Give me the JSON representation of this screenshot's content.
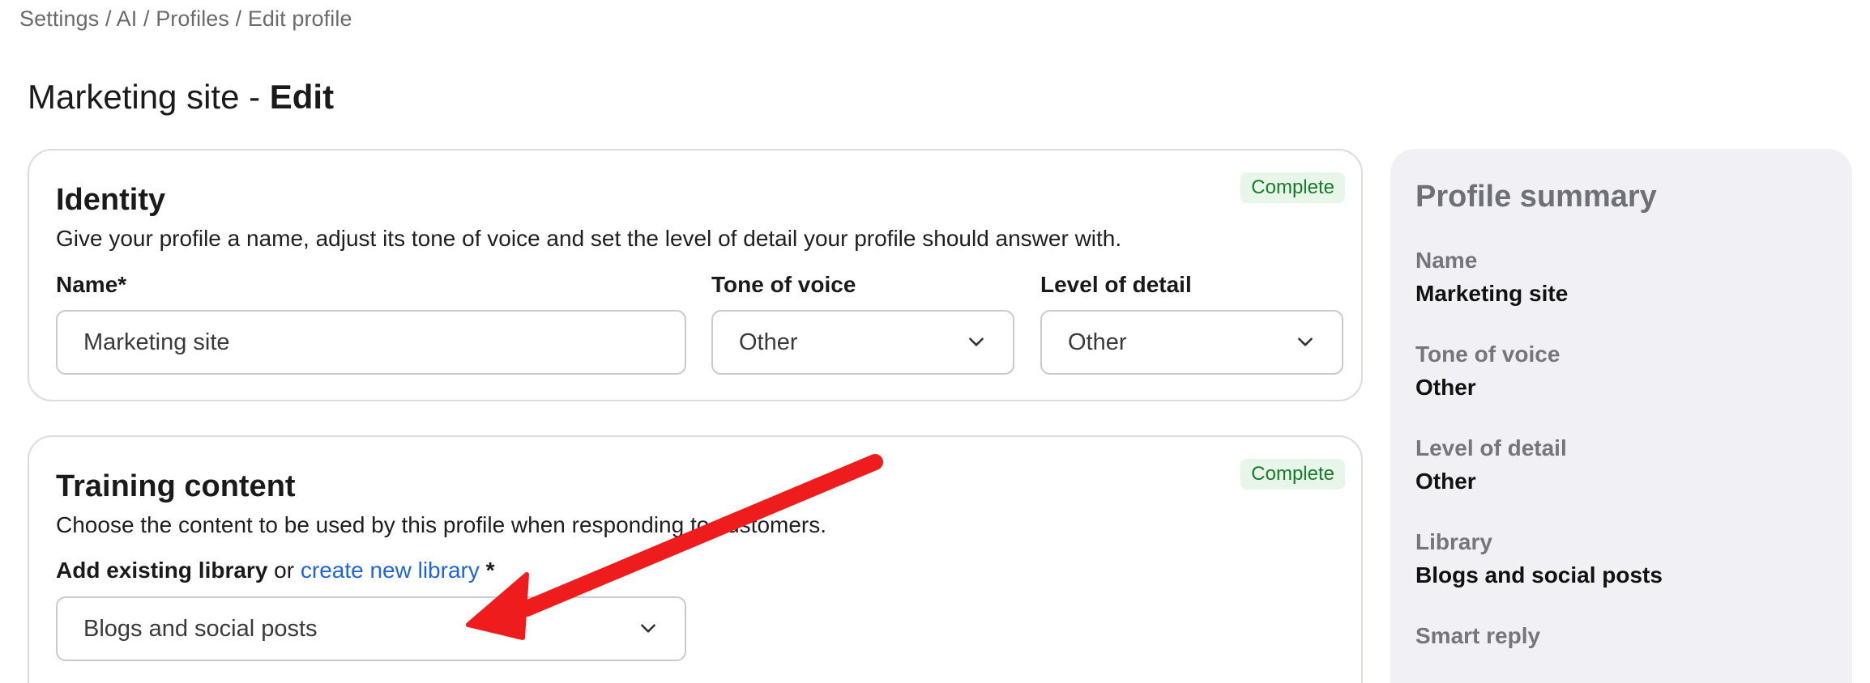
{
  "breadcrumb": "Settings / AI / Profiles / Edit profile",
  "page_title": {
    "name": "Marketing site - ",
    "action": "Edit"
  },
  "identity": {
    "title": "Identity",
    "badge": "Complete",
    "description": "Give your profile a name, adjust its tone of voice and set the level of detail your profile should answer with.",
    "name_label": "Name",
    "name_required": "*",
    "name_value": "Marketing site",
    "tone_label": "Tone of voice",
    "tone_value": "Other",
    "detail_label": "Level of detail",
    "detail_value": "Other"
  },
  "training": {
    "title": "Training content",
    "badge": "Complete",
    "description": "Choose the content to be used by this profile when responding to customers.",
    "library_label": "Add existing library",
    "or_text": " or ",
    "create_link": "create new library",
    "required": " *",
    "library_value": "Blogs and social posts"
  },
  "summary": {
    "title": "Profile summary",
    "items": [
      {
        "label": "Name",
        "value": "Marketing site"
      },
      {
        "label": "Tone of voice",
        "value": "Other"
      },
      {
        "label": "Level of detail",
        "value": "Other"
      },
      {
        "label": "Library",
        "value": "Blogs and social posts"
      },
      {
        "label": "Smart reply",
        "value": ""
      }
    ]
  },
  "colors": {
    "badge_bg": "#e7f6e9",
    "badge_text": "#177a2b",
    "link": "#1f64d8",
    "annotation_arrow": "#ee1c1c"
  },
  "icons": {
    "dropdown": "chevron-down-icon"
  }
}
